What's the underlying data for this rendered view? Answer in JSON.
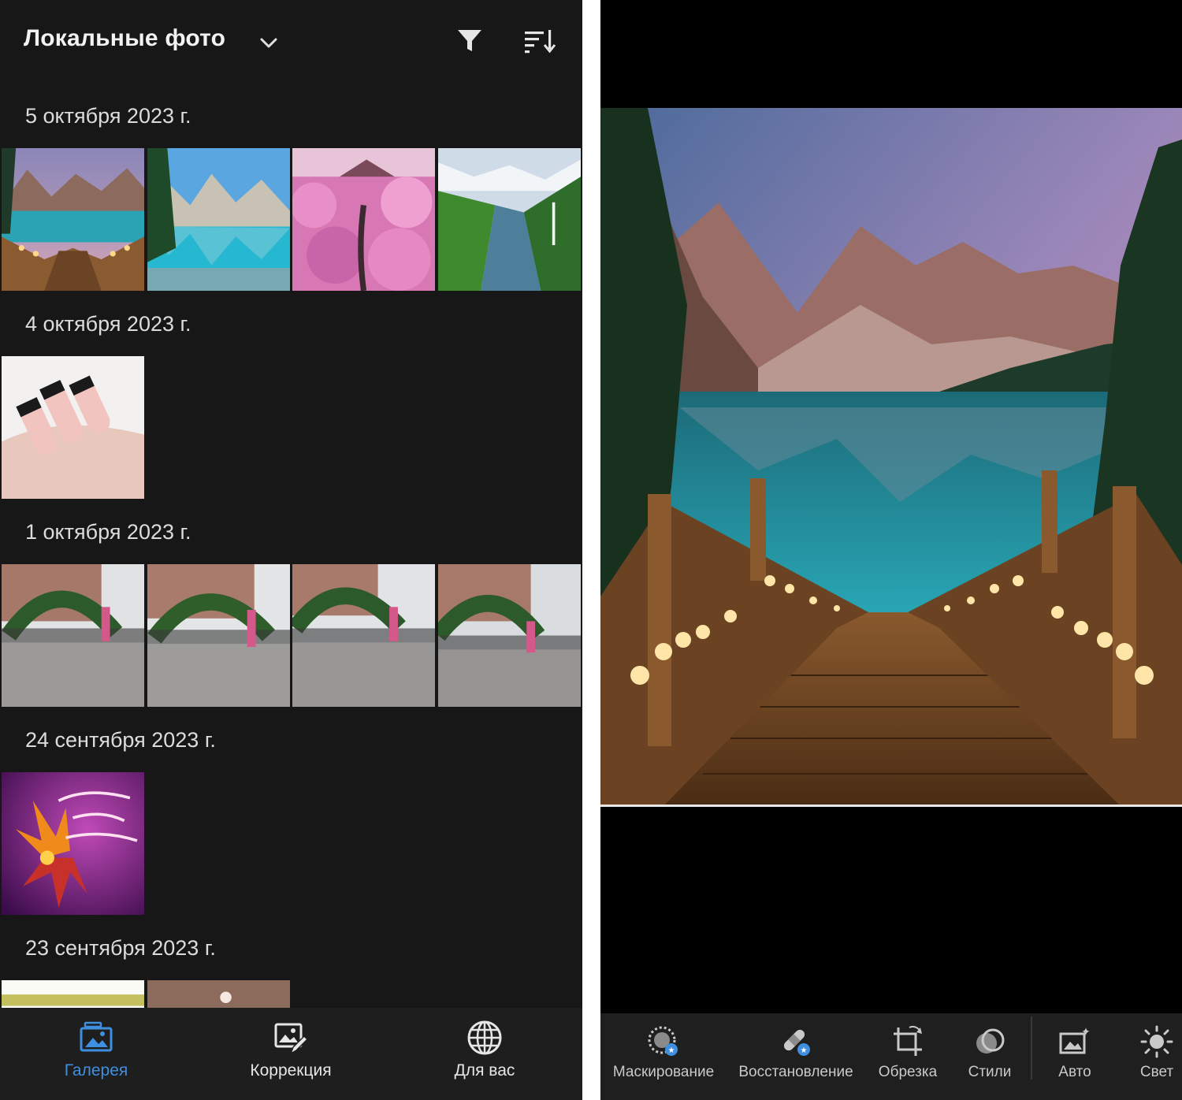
{
  "gallery": {
    "title": "Локальные фото",
    "icons": {
      "dropdown": "chevron-down-icon",
      "filter": "filter-icon",
      "sort": "sort-icon"
    },
    "sections": [
      {
        "date": "5 октября 2023 г.",
        "photos": [
          "lake-boardwalk",
          "mountain-lake",
          "pink-blossom-mountain",
          "fjord-waterfall"
        ]
      },
      {
        "date": "4 октября 2023 г.",
        "photos": [
          "manicure-nails"
        ]
      },
      {
        "date": "1 октября 2023 г.",
        "photos": [
          "flower-arch-1",
          "flower-arch-2",
          "flower-arch-3",
          "flower-arch-4"
        ]
      },
      {
        "date": "24 сентября 2023 г.",
        "photos": [
          "birthday-card"
        ]
      },
      {
        "date": "23 сентября 2023 г.",
        "photos": [
          "table-screenshot",
          "blurred-room"
        ]
      }
    ],
    "nav": [
      {
        "label": "Галерея",
        "icon": "gallery-icon",
        "active": true
      },
      {
        "label": "Коррекция",
        "icon": "edit-photo-icon",
        "active": false
      },
      {
        "label": "Для вас",
        "icon": "globe-icon",
        "active": false
      }
    ],
    "colors": {
      "background": "#171717",
      "accent": "#3f8fe0"
    }
  },
  "editor": {
    "photo": "lake-boardwalk",
    "tools": [
      {
        "label": "Маскирование",
        "icon": "masking-icon"
      },
      {
        "label": "Восстановление",
        "icon": "healing-icon"
      },
      {
        "label": "Обрезка",
        "icon": "crop-icon"
      },
      {
        "label": "Стили",
        "icon": "styles-icon"
      },
      {
        "label": "Авто",
        "icon": "auto-icon"
      },
      {
        "label": "Свет",
        "icon": "light-icon"
      }
    ]
  }
}
